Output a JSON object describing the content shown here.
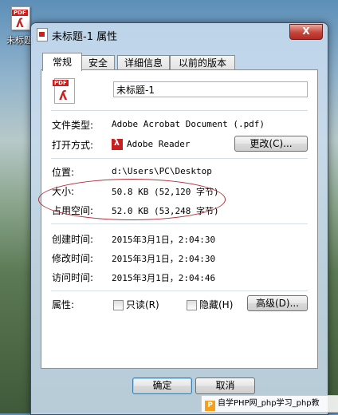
{
  "desktop": {
    "icon_label": "未标题",
    "icon_tag": "PDF"
  },
  "window": {
    "title": "未标题-1 属性",
    "close_label": "X"
  },
  "tabs": [
    {
      "label": "常规",
      "active": true
    },
    {
      "label": "安全",
      "active": false
    },
    {
      "label": "详细信息",
      "active": false
    },
    {
      "label": "以前的版本",
      "active": false
    }
  ],
  "general": {
    "file_name": "未标题-1",
    "file_type_label": "文件类型:",
    "file_type_value": "Adobe Acrobat Document (.pdf)",
    "open_with_label": "打开方式:",
    "open_with_value": "Adobe Reader",
    "change_button": "更改(C)...",
    "location_label": "位置:",
    "location_value": "d:\\Users\\PC\\Desktop",
    "size_label": "大小:",
    "size_value": "50.8 KB (52,120 字节)",
    "size_on_disk_label": "占用空间:",
    "size_on_disk_value": "52.0 KB (53,248 字节)",
    "created_label": "创建时间:",
    "created_value": "2015年3月1日，2:04:30",
    "modified_label": "修改时间:",
    "modified_value": "2015年3月1日，2:04:30",
    "accessed_label": "访问时间:",
    "accessed_value": "2015年3月1日，2:04:46",
    "attributes_label": "属性:",
    "readonly_label": "只读(R)",
    "hidden_label": "隐藏(H)",
    "advanced_button": "高级(D)..."
  },
  "footer": {
    "ok_button": "确定",
    "cancel_button": "取消"
  },
  "watermark": {
    "logo": "P",
    "text": "自学PHP网_php学习_php教"
  },
  "colors": {
    "annotation_oval": "#b3303a",
    "pdf_red": "#c81f1f"
  }
}
